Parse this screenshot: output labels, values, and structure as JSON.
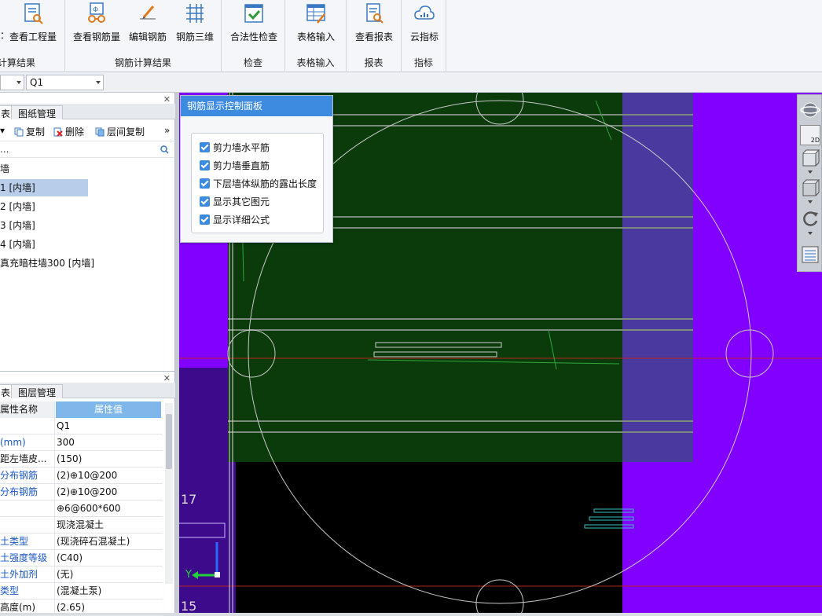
{
  "ribbon": {
    "groups": [
      {
        "label": "计算结果",
        "buttons": [
          {
            "label": "查看工程量",
            "icon": "quantity-report-icon"
          }
        ]
      },
      {
        "label": "钢筋计算结果",
        "buttons": [
          {
            "label": "查看钢筋量",
            "icon": "rebar-glasses-icon"
          },
          {
            "label": "编辑钢筋",
            "icon": "edit-rebar-icon"
          },
          {
            "label": "钢筋三维",
            "icon": "rebar-3d-icon"
          }
        ]
      },
      {
        "label": "检查",
        "buttons": [
          {
            "label": "合法性检查",
            "icon": "check-icon"
          }
        ]
      },
      {
        "label": "表格输入",
        "buttons": [
          {
            "label": "表格输入",
            "icon": "table-input-icon"
          }
        ]
      },
      {
        "label": "报表",
        "buttons": [
          {
            "label": "查看报表",
            "icon": "report-icon"
          }
        ]
      },
      {
        "label": "指标",
        "buttons": [
          {
            "label": "云指标",
            "icon": "cloud-icon"
          }
        ]
      }
    ],
    "truncated_left_label": "："
  },
  "combobar": {
    "component_value": "Q1"
  },
  "top_panel": {
    "tabs": [
      "表",
      "图纸管理"
    ],
    "toolbar": {
      "copy": "复制",
      "delete": "删除",
      "floor_copy": "层间复制",
      "more": "»"
    },
    "search_placeholder": "...",
    "tree": [
      {
        "label": "墙",
        "selected": false
      },
      {
        "label": "1 [内墙]",
        "selected": true
      },
      {
        "label": "2 [内墙]",
        "selected": false
      },
      {
        "label": "3 [内墙]",
        "selected": false
      },
      {
        "label": "4 [内墙]",
        "selected": false
      },
      {
        "label": "真充暗柱墙300 [内墙]",
        "selected": false
      }
    ]
  },
  "bottom_panel": {
    "tabs": [
      "表",
      "图层管理"
    ],
    "header": {
      "name": "属性名称",
      "value": "属性值"
    },
    "rows": [
      {
        "name": "",
        "value": "Q1",
        "blue": false
      },
      {
        "name": "(mm)",
        "value": "300",
        "blue": true
      },
      {
        "name": "距左墙皮...",
        "value": "(150)",
        "blue": false
      },
      {
        "name": "分布钢筋",
        "value": "(2)⊕10@200",
        "blue": true
      },
      {
        "name": "分布钢筋",
        "value": "(2)⊕10@200",
        "blue": true
      },
      {
        "name": "",
        "value": "⊕6@600*600",
        "blue": false
      },
      {
        "name": "",
        "value": "现浇混凝土",
        "blue": false
      },
      {
        "name": "土类型",
        "value": "(现浇碎石混凝土)",
        "blue": true
      },
      {
        "name": "土强度等级",
        "value": "(C40)",
        "blue": true
      },
      {
        "name": "土外加剂",
        "value": "(无)",
        "blue": true
      },
      {
        "name": "类型",
        "value": "(混凝土泵)",
        "blue": true
      },
      {
        "name": "高度(m)",
        "value": "(2.65)",
        "blue": false
      }
    ]
  },
  "control_panel": {
    "title": "钢筋显示控制面板",
    "options": [
      {
        "label": "剪力墙水平筋",
        "checked": true
      },
      {
        "label": "剪力墙垂直筋",
        "checked": true
      },
      {
        "label": "下层墙体纵筋的露出长度",
        "checked": true
      },
      {
        "label": "显示其它图元",
        "checked": true
      },
      {
        "label": "显示详细公式",
        "checked": true
      }
    ]
  },
  "canvas": {
    "axis_numbers": [
      "17",
      "15"
    ],
    "axis_label_y": "Y",
    "colors": {
      "purple": "#8200ff",
      "dark_green": "#0b3a0b",
      "violet_overlay": "#4a3aa0"
    }
  },
  "viewbar": {
    "label_2d": "2D"
  }
}
